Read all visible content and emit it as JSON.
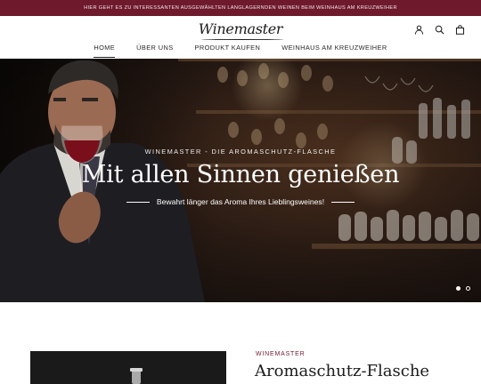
{
  "announcement": "Hier geht es zu interessanten ausgewählten langlagernden Weinen beim Weinhaus am Kreuzweiher",
  "brand": {
    "logo": "Winemaster",
    "accent_color": "#6e1a2c"
  },
  "header": {
    "icons": [
      "account-icon",
      "search-icon",
      "cart-icon"
    ]
  },
  "nav": {
    "items": [
      {
        "label": "Home",
        "active": true
      },
      {
        "label": "Über uns",
        "active": false
      },
      {
        "label": "Produkt kaufen",
        "active": false
      },
      {
        "label": "Weinhaus am Kreuzweiher",
        "active": false
      }
    ]
  },
  "hero": {
    "kicker": "Winemaster - Die Aromaschutz-Flasche",
    "title": "Mit allen Sinnen genießen",
    "subtitle": "Bewahrt länger das Aroma Ihres Lieblingsweines!",
    "slides": {
      "count": 2,
      "active": 1
    }
  },
  "product": {
    "vendor": "Winemaster",
    "title": "Aromaschutz-Flasche"
  }
}
